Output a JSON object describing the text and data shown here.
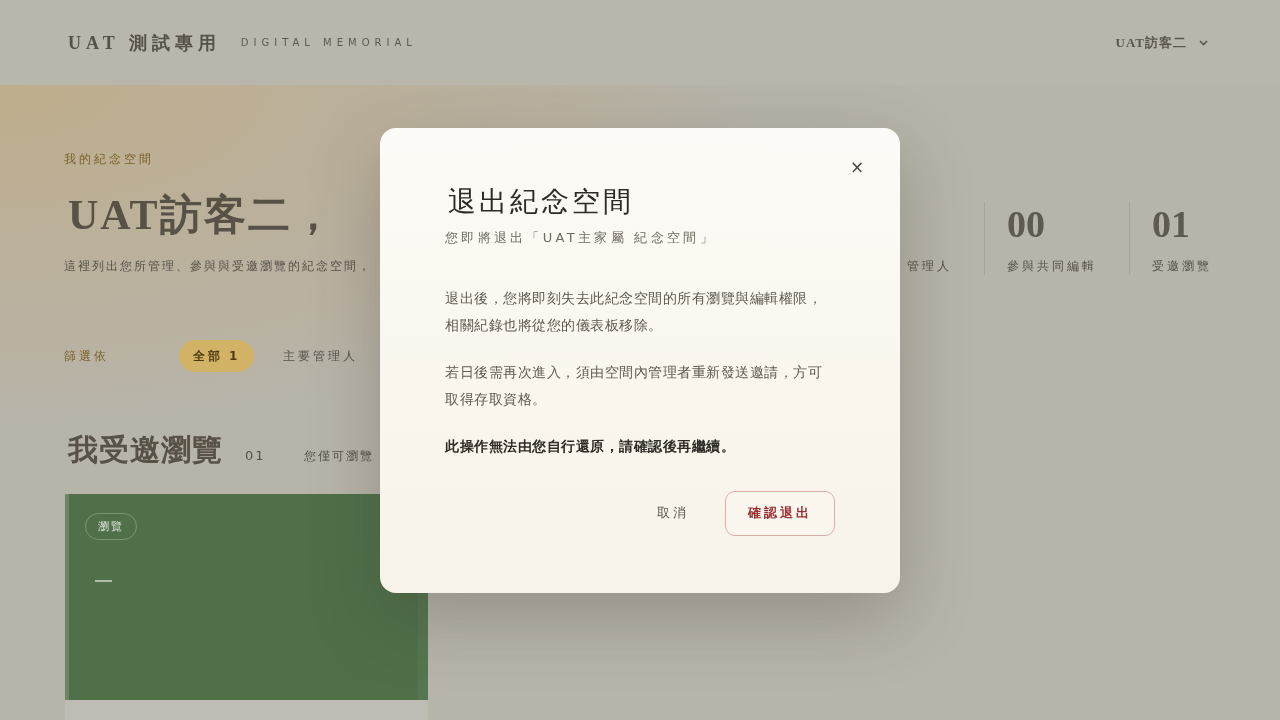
{
  "header": {
    "brand": "UAT 測試專用",
    "tagline": "DIGITAL MEMORIAL",
    "user_menu": {
      "label": "UAT訪客二"
    }
  },
  "hero": {
    "eyebrow": "我的紀念空間",
    "title": "UAT訪客二，",
    "subtitle": "這裡列出您所管理、參與與受邀瀏覽的紀念空間，"
  },
  "stats": [
    {
      "label": "管理人"
    },
    {
      "value": "00",
      "label": "參與共同編輯"
    },
    {
      "value": "01",
      "label": "受邀瀏覽"
    }
  ],
  "filters": {
    "label": "篩選依",
    "options": [
      {
        "label": "全部",
        "count": "1",
        "selected": true
      },
      {
        "label": "主要管理人",
        "selected": false
      }
    ]
  },
  "section": {
    "title": "我受邀瀏覽",
    "count": "01",
    "note": "您僅可瀏覽"
  },
  "cards": [
    {
      "tag": "瀏覽"
    }
  ],
  "dialog": {
    "close": "×",
    "title": "退出紀念空間",
    "subtitle": "您即將退出「UAT主家屬 紀念空間」",
    "paragraphs": [
      {
        "kind": "normal",
        "text": "退出後，您將即刻失去此紀念空間的所有瀏覽與編輯權限，相關紀錄也將從您的儀表板移除。"
      },
      {
        "kind": "normal",
        "text": "若日後需再次進入，須由空間內管理者重新發送邀請，方可取得存取資格。"
      },
      {
        "kind": "warning",
        "text": "此操作無法由您自行還原，請確認後再繼續。"
      }
    ],
    "buttons": [
      {
        "kind": "secondary",
        "label": "取消"
      },
      {
        "kind": "danger",
        "label": "確認退出"
      }
    ]
  }
}
